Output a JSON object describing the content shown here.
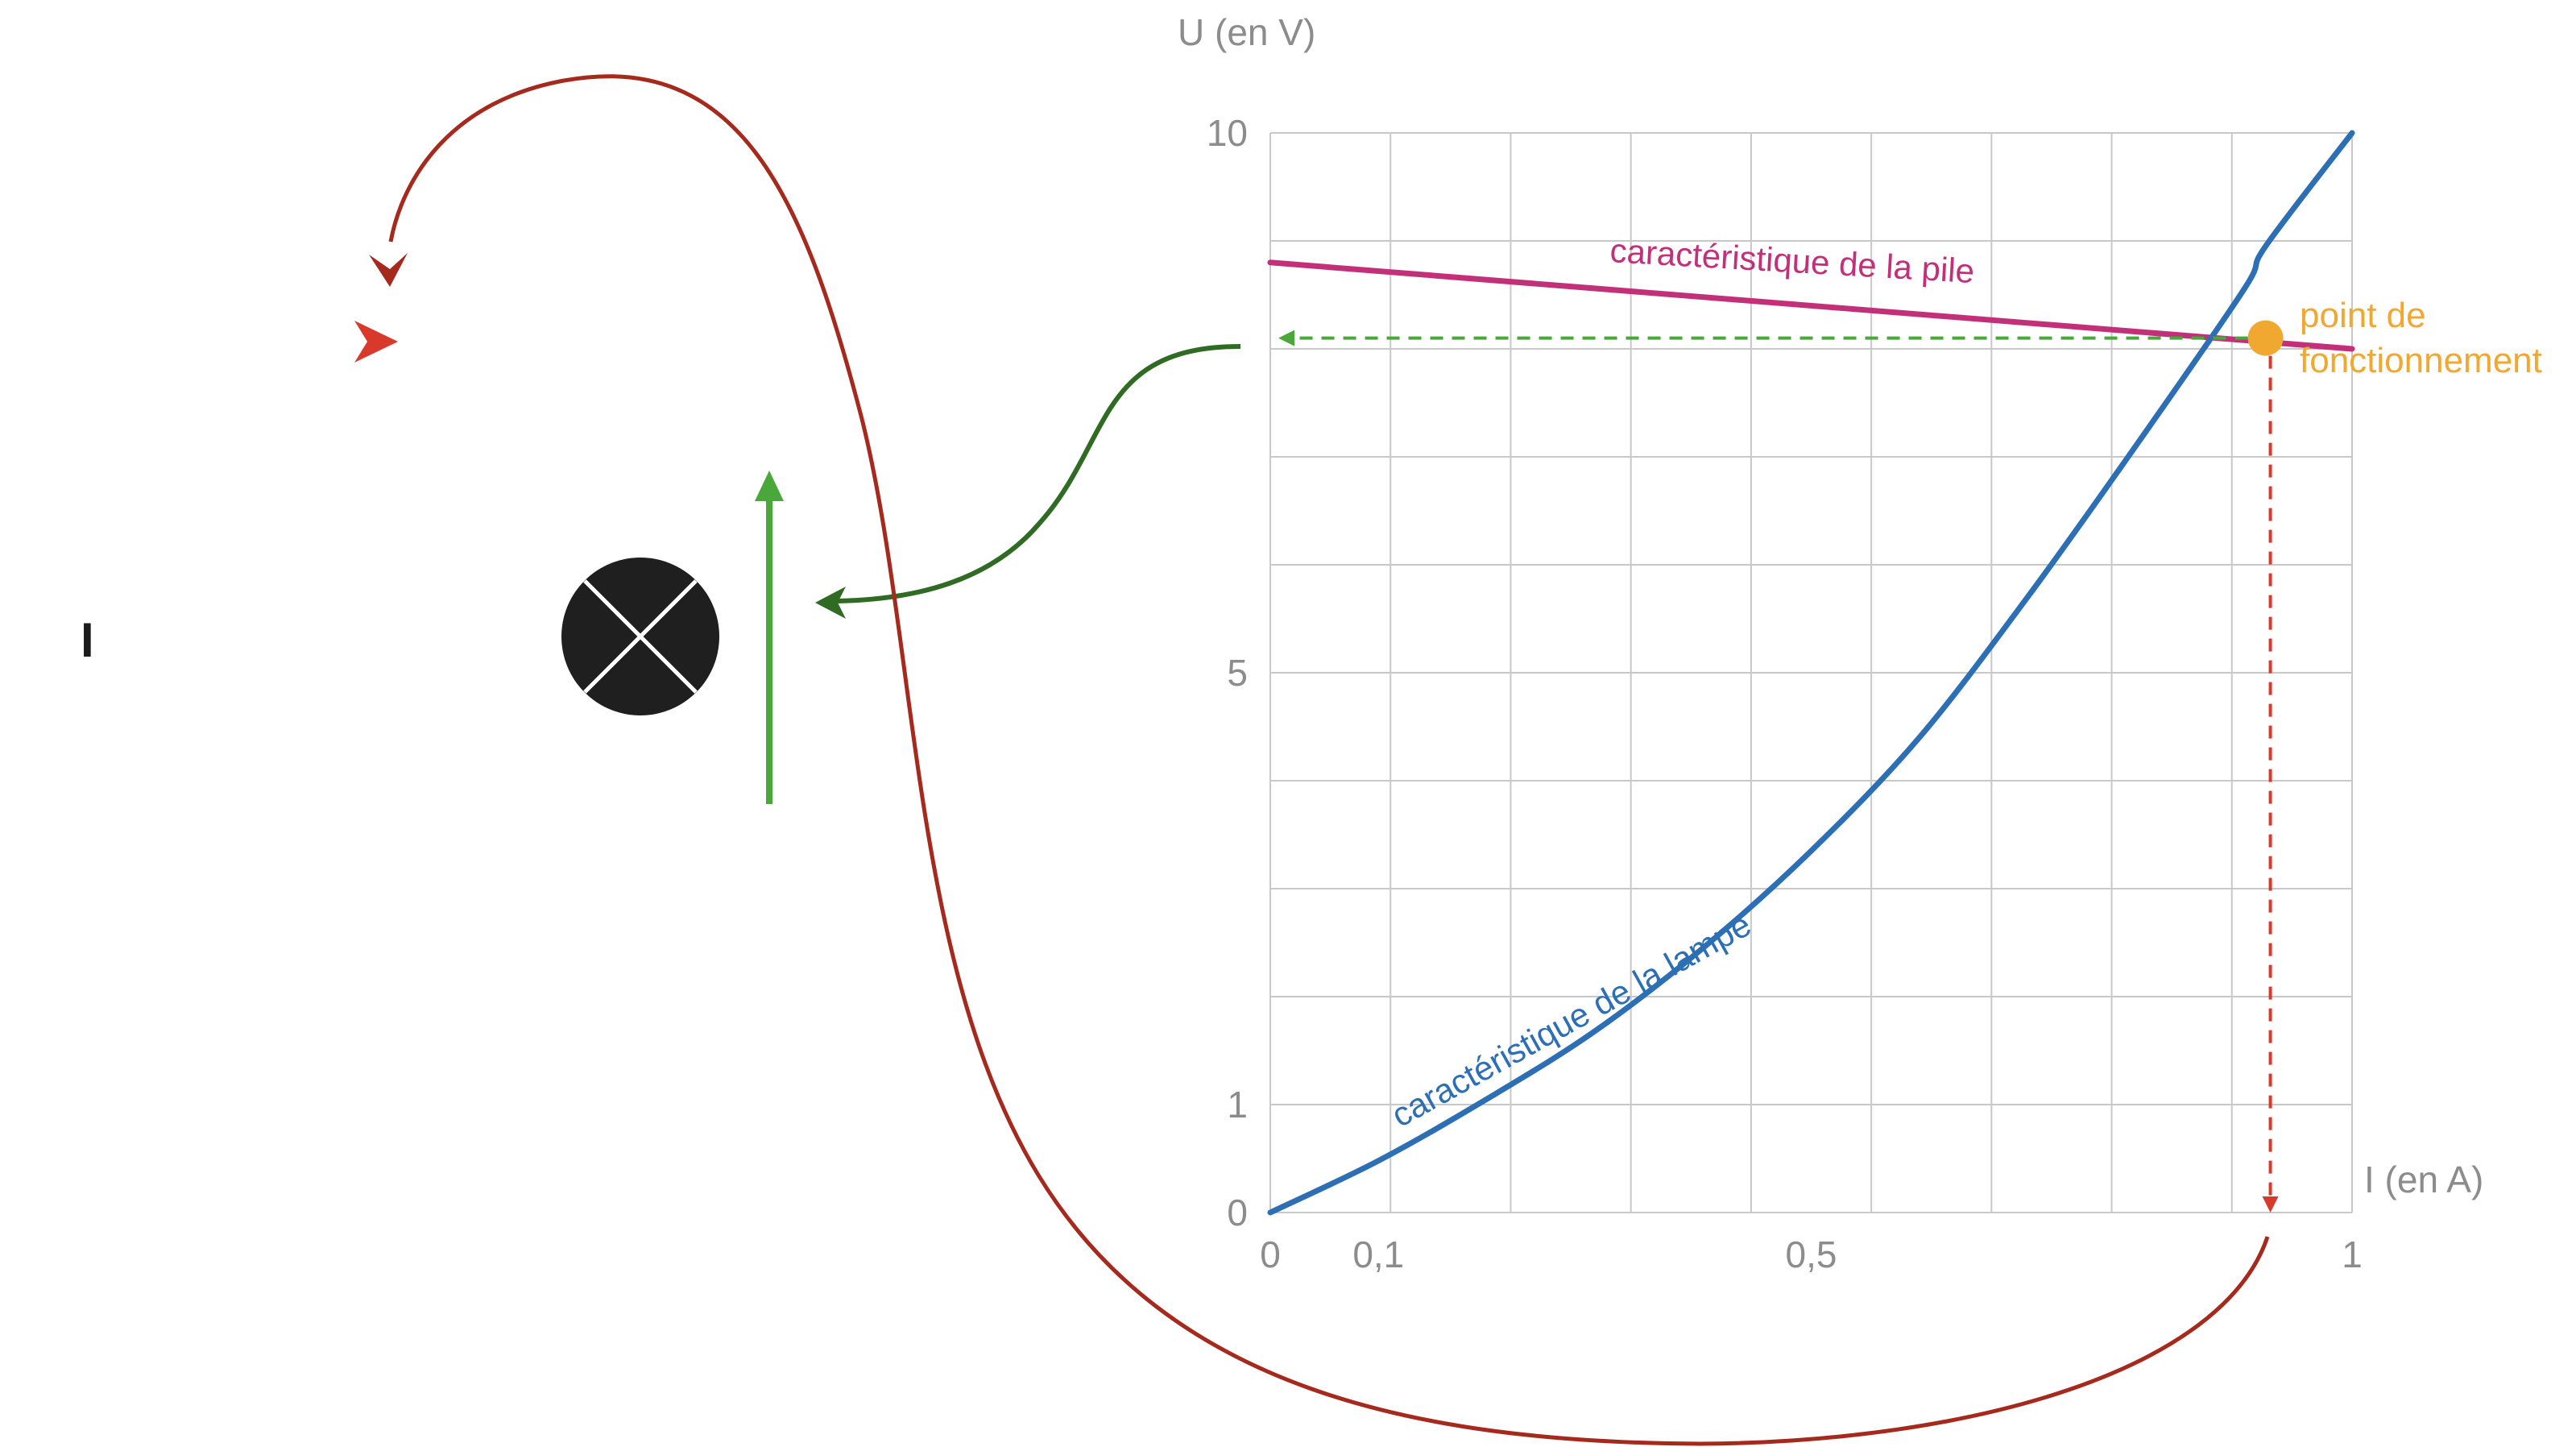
{
  "chart_data": {
    "type": "line",
    "xlabel": "I (en A)",
    "ylabel": "U (en V)",
    "xlim": [
      0,
      1
    ],
    "ylim": [
      0,
      10
    ],
    "grid": true,
    "x_ticks": [
      {
        "value": 0,
        "label": "0"
      },
      {
        "value": 0.1,
        "label": "0,1"
      },
      {
        "value": 0.5,
        "label": "0,5"
      },
      {
        "value": 1,
        "label": "1"
      }
    ],
    "y_ticks": [
      {
        "value": 0,
        "label": "0"
      },
      {
        "value": 1,
        "label": "1"
      },
      {
        "value": 5,
        "label": "5"
      },
      {
        "value": 10,
        "label": "10"
      }
    ],
    "series": [
      {
        "name": "caractéristique de la pile",
        "color": "#c2307a",
        "x": [
          0,
          1
        ],
        "y": [
          8.8,
          8.0
        ]
      },
      {
        "name": "caractéristique de la lampe",
        "color": "#2c6fb5",
        "x": [
          0,
          0.1,
          0.2,
          0.3,
          0.4,
          0.5,
          0.6,
          0.7,
          0.8,
          0.9,
          0.92,
          1.0
        ],
        "y": [
          0,
          0.48,
          1.05,
          1.68,
          2.45,
          3.35,
          4.4,
          5.7,
          7.1,
          8.55,
          8.95,
          10.0
        ]
      }
    ],
    "operating_point": {
      "label": "point de\nfonctionnement",
      "x": 0.92,
      "y": 8.1,
      "color": "#f0a830"
    },
    "projection_colors": {
      "voltage": "#4aa83a",
      "current": "#d8392b"
    }
  },
  "circuit": {
    "current_label": "I",
    "lamp_icon": "lamp-icon",
    "voltage_arrow_color": "#4aa83a",
    "current_arrow_color": "#d8392b",
    "connector_green_color": "#2f6b22",
    "connector_red_color": "#a5291c"
  }
}
